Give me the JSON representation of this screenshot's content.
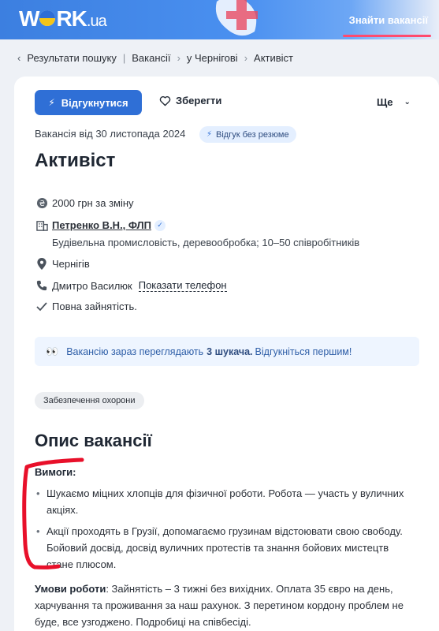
{
  "header": {
    "logo_main": "WORK",
    "logo_suffix": ".ua",
    "find_link": "Знайти вакансії"
  },
  "breadcrumb": {
    "items": [
      "Результати пошуку",
      "Вакансії",
      "у Чернігові",
      "Активіст"
    ]
  },
  "actions": {
    "apply_label": "Відгукнутися",
    "save_label": "Зберегти",
    "more_label": "Ще"
  },
  "vacancy": {
    "posted": "Вакансія від 30 листопада 2024",
    "badge": "Відгук без резюме",
    "title": "Активіст",
    "salary": "2000 грн за зміну",
    "employer": "Петренко В.Н., ФЛП",
    "industry": "Будівельна промисловість, деревообробка; 10–50 співробітників",
    "city": "Чернігів",
    "contact_name": "Дмитро Василюк",
    "show_phone": "Показати телефон",
    "employment": "Повна зайнятість."
  },
  "notice": {
    "before": "Вакансію зараз переглядають",
    "count": "3 шукача.",
    "after": "Відгукніться першим!"
  },
  "tag": "Забезпечення охорони",
  "description": {
    "title": "Опис вакансії",
    "requirements_label": "Вимоги:",
    "requirements": [
      "Шукаємо міцних хлопців для фізичної роботи. Робота — участь у вуличних акціях.",
      "Акції проходять в Грузії, допомагаємо грузинам відстоювати свою свободу. Бойовий досвід, досвід вуличних протестів та знання бойових мистецтв стане плюсом."
    ],
    "conditions_label": "Умови роботи",
    "conditions_text": ": Зайнятість – 3 тижні без вихідних. Оплата 35 євро на день, харчування та проживання за наш рахунок. З перетином кордону проблем не буде, все узгоджено. Подробиці на співбесіді."
  },
  "colors": {
    "brand_blue": "#2f6fd6",
    "accent_red": "#ff4b6e",
    "annotation_red": "#e8102a"
  }
}
